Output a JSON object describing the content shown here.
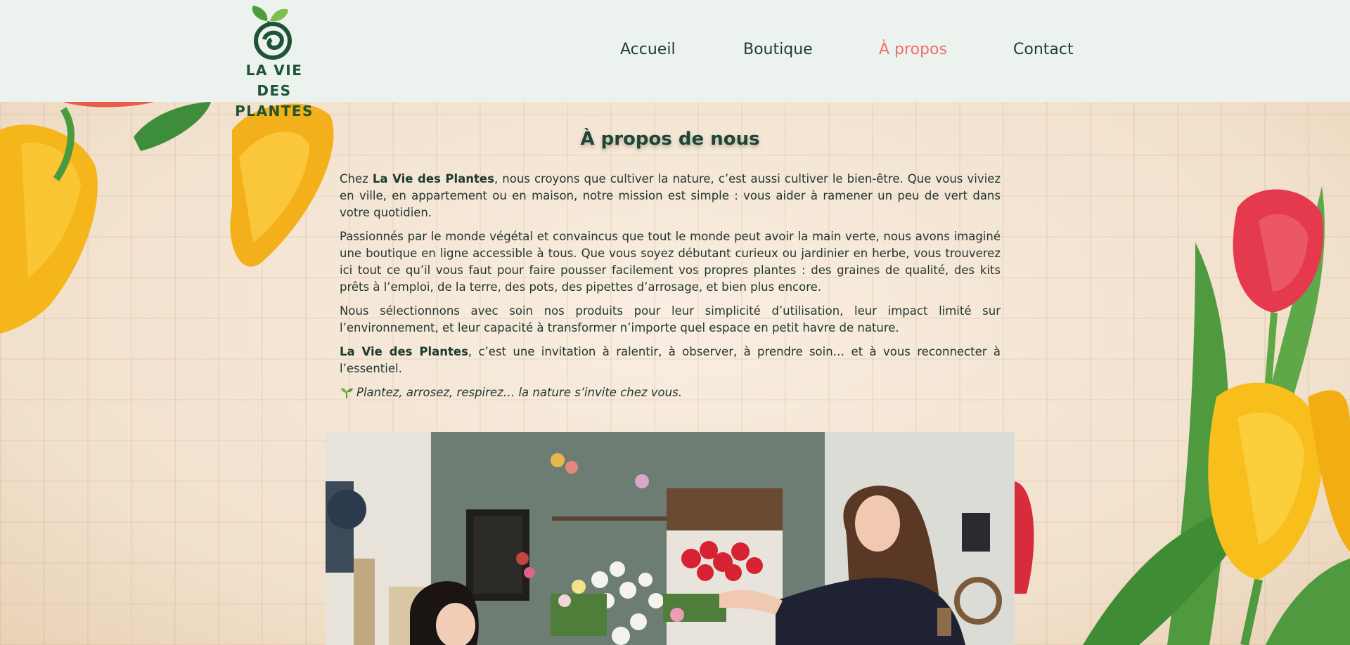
{
  "brand": {
    "line1": "LA VIE DES",
    "line2": "PLANTES",
    "color": "#1e5335"
  },
  "nav": {
    "items": [
      "Accueil",
      "Boutique",
      "À propos",
      "Contact"
    ],
    "active_index": 2,
    "active_color": "#ef6f6c"
  },
  "about": {
    "title": "À propos de nous",
    "p1_pre": "Chez ",
    "p1_bold": "La Vie des Plantes",
    "p1_post": ", nous croyons que cultiver la nature, c’est aussi cultiver le bien-être. Que vous viviez en ville, en appartement ou en maison, notre mission est simple : vous aider à ramener un peu de vert dans votre quotidien.",
    "p2": "Passionnés par le monde végétal et convaincus que tout le monde peut avoir la main verte, nous avons imaginé une boutique en ligne accessible à tous. Que vous soyez débutant curieux ou jardinier en herbe, vous trouverez ici tout ce qu’il vous faut pour faire pousser facilement vos propres plantes : des graines de qualité, des kits prêts à l’emploi, de la terre, des pots, des pipettes d’arrosage, et bien plus encore.",
    "p3": "Nous sélectionnons avec soin nos produits pour leur simplicité d’utilisation, leur impact limité sur l’environnement, et leur capacité à transformer n’importe quel espace en petit havre de nature.",
    "p4_bold": "La Vie des Plantes",
    "p4_post": ", c’est une invitation à ralentir, à observer, à prendre soin… et à vous reconnecter à l’essentiel.",
    "tagline": "Plantez, arrosez, respirez… la nature s’invite chez vous.",
    "tagline_icon": "seedling-icon"
  }
}
